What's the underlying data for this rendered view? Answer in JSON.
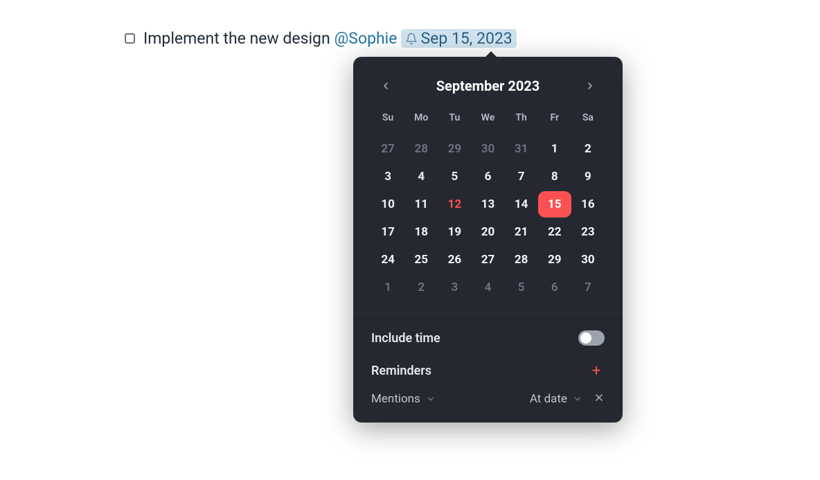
{
  "task": {
    "text": "Implement the new design",
    "mention": "@Sophie",
    "date_label": "Sep 15, 2023"
  },
  "calendar": {
    "month_title": "September 2023",
    "weekdays": [
      "Su",
      "Mo",
      "Tu",
      "We",
      "Th",
      "Fr",
      "Sa"
    ],
    "today": 12,
    "selected": 15,
    "days": [
      {
        "n": 27,
        "other": true
      },
      {
        "n": 28,
        "other": true
      },
      {
        "n": 29,
        "other": true
      },
      {
        "n": 30,
        "other": true
      },
      {
        "n": 31,
        "other": true
      },
      {
        "n": 1
      },
      {
        "n": 2
      },
      {
        "n": 3
      },
      {
        "n": 4
      },
      {
        "n": 5
      },
      {
        "n": 6
      },
      {
        "n": 7
      },
      {
        "n": 8
      },
      {
        "n": 9
      },
      {
        "n": 10
      },
      {
        "n": 11
      },
      {
        "n": 12
      },
      {
        "n": 13
      },
      {
        "n": 14
      },
      {
        "n": 15
      },
      {
        "n": 16
      },
      {
        "n": 17
      },
      {
        "n": 18
      },
      {
        "n": 19
      },
      {
        "n": 20
      },
      {
        "n": 21
      },
      {
        "n": 22
      },
      {
        "n": 23
      },
      {
        "n": 24
      },
      {
        "n": 25
      },
      {
        "n": 26
      },
      {
        "n": 27
      },
      {
        "n": 28
      },
      {
        "n": 29
      },
      {
        "n": 30
      },
      {
        "n": 1,
        "other": true
      },
      {
        "n": 2,
        "other": true
      },
      {
        "n": 3,
        "other": true
      },
      {
        "n": 4,
        "other": true
      },
      {
        "n": 5,
        "other": true
      },
      {
        "n": 6,
        "other": true
      },
      {
        "n": 7,
        "other": true
      }
    ]
  },
  "options": {
    "include_time_label": "Include time",
    "include_time_value": false,
    "reminders_label": "Reminders",
    "reminder_kind": "Mentions",
    "reminder_when": "At date"
  }
}
